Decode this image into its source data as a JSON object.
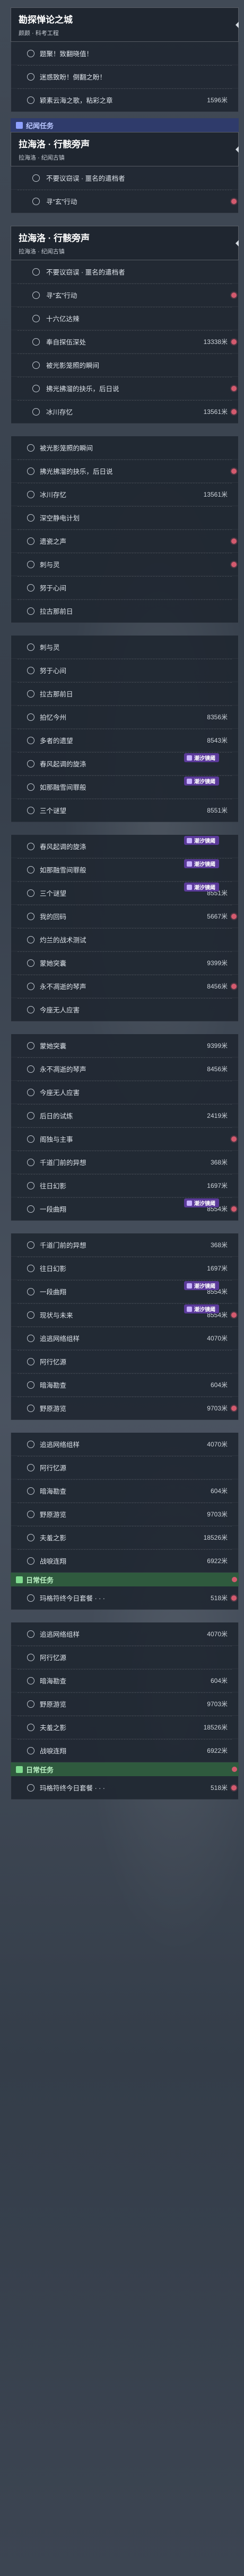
{
  "top_header": {
    "title": "勘探惮论之城",
    "subtitle": "颜颜 · 科考工程"
  },
  "top_rows": [
    {
      "label": "题聚！致翻晓值！",
      "value": "",
      "dot": false
    },
    {
      "label": "迷惑致盼！倒翻之盼！",
      "value": "",
      "dot": false
    },
    {
      "label": "颖素云海之歌，粘彩之章",
      "value": "1596米",
      "dot": false
    }
  ],
  "sections": {
    "story": "纪闻任务",
    "daily": "日常任务",
    "daily2": "日常任务"
  },
  "group_a_header": {
    "title": "拉海洛 · 行骸旁声",
    "subtitle": "拉海洛 · 纪闻古镇"
  },
  "group_a_rows": [
    {
      "label": "不要议窃误 · 噩名的遣档者",
      "value": "",
      "dot": false
    },
    {
      "label": "寻“玄”行动",
      "value": "",
      "dot": true
    }
  ],
  "group_b_header": {
    "title": "拉海洛 · 行骸旁声",
    "subtitle": "拉海洛 · 纪闻古镇"
  },
  "group_b_rows": [
    {
      "label": "不要议窃误 · 噩名的遣档者",
      "value": "",
      "dot": false
    },
    {
      "label": "寻“玄”行动",
      "value": "",
      "dot": true
    },
    {
      "label": "十六亿达辣",
      "value": "",
      "dot": false
    },
    {
      "label": "奉自探伍深处",
      "value": "13338米",
      "dot": true
    },
    {
      "label": "被光影笼照的瞬间",
      "value": "",
      "dot": false
    },
    {
      "label": "拂光拂溜的抉乐，后日说",
      "value": "",
      "dot": true
    },
    {
      "label": "冰川存忆",
      "value": "13561米",
      "dot": true
    }
  ],
  "group_c_rows": [
    {
      "label": "被光影笼照的瞬间",
      "value": "",
      "dot": false
    },
    {
      "label": "拂光拂溜的抉乐，后日说",
      "value": "",
      "dot": true
    },
    {
      "label": "冰川存忆",
      "value": "13561米",
      "dot": false
    },
    {
      "label": "深空静电计划",
      "value": "",
      "dot": false
    },
    {
      "label": "遗瓷之声",
      "value": "",
      "dot": true
    },
    {
      "label": "刺与灵",
      "value": "",
      "dot": true
    },
    {
      "label": "努于心间",
      "value": "",
      "dot": false
    },
    {
      "label": "拉古那前日",
      "value": "",
      "dot": false
    }
  ],
  "group_d_rows": [
    {
      "label": "刺与灵",
      "value": "",
      "dot": false
    },
    {
      "label": "努于心间",
      "value": "",
      "dot": false
    },
    {
      "label": "拉古那前日",
      "value": "",
      "dot": false
    },
    {
      "label": "拍忆今州",
      "value": "8356米",
      "dot": false
    },
    {
      "label": "多者的遗望",
      "value": "8543米",
      "dot": false
    },
    {
      "label": "春风起调的旋涤",
      "value": "",
      "dot": false,
      "badge": "潮汐镜阈"
    },
    {
      "label": "如那融雪间罪般",
      "value": "",
      "dot": false,
      "badge": "潮汐镜阈"
    },
    {
      "label": "三个谜望",
      "value": "8551米",
      "dot": false
    }
  ],
  "group_e_rows": [
    {
      "label": "春风起调的旋涤",
      "value": "",
      "dot": false,
      "badge": "潮汐镜阈"
    },
    {
      "label": "如那融雪间罪般",
      "value": "",
      "dot": false,
      "badge": "潮汐镜阈"
    },
    {
      "label": "三个谜望",
      "value": "8551米",
      "dot": false,
      "badge": "潮汐镜阈"
    },
    {
      "label": "我的回码",
      "value": "5667米",
      "dot": true
    },
    {
      "label": "灼兰的战术测试",
      "value": "",
      "dot": false
    },
    {
      "label": "蒙她突囊",
      "value": "9399米",
      "dot": false
    },
    {
      "label": "永不凋逝的琴声",
      "value": "8456米",
      "dot": true
    },
    {
      "label": "今座无人应害",
      "value": "",
      "dot": false
    }
  ],
  "group_f_rows": [
    {
      "label": "蒙她突囊",
      "value": "9399米",
      "dot": false
    },
    {
      "label": "永不凋逝的琴声",
      "value": "8456米",
      "dot": false
    },
    {
      "label": "今座无人应害",
      "value": "",
      "dot": false
    },
    {
      "label": "后日的试炼",
      "value": "2419米",
      "dot": false
    },
    {
      "label": "阁独与主事",
      "value": "",
      "dot": true
    },
    {
      "label": "千道门前的异想",
      "value": "368米",
      "dot": false
    },
    {
      "label": "往日幻影",
      "value": "1697米",
      "dot": false
    },
    {
      "label": "一段曲翔",
      "value": "8554米",
      "dot": true,
      "badge": "潮汐镜阈"
    }
  ],
  "group_g_rows": [
    {
      "label": "千道门前的异想",
      "value": "368米",
      "dot": false
    },
    {
      "label": "往日幻影",
      "value": "1697米",
      "dot": false
    },
    {
      "label": "一段曲翔",
      "value": "8554米",
      "dot": false,
      "badge": "潮汐镜阈"
    },
    {
      "label": "现状与未来",
      "value": "8554米",
      "dot": true,
      "badge": "潮汐镜阈"
    },
    {
      "label": "追逃网络组样",
      "value": "4070米",
      "dot": false
    },
    {
      "label": "阿行忆源",
      "value": "",
      "dot": false
    },
    {
      "label": "暗海勘查",
      "value": "604米",
      "dot": false
    },
    {
      "label": "野原游览",
      "value": "9703米",
      "dot": true
    }
  ],
  "group_h_rows": [
    {
      "label": "追逃网络组样",
      "value": "4070米",
      "dot": false
    },
    {
      "label": "阿行忆源",
      "value": "",
      "dot": false
    },
    {
      "label": "暗海勘查",
      "value": "604米",
      "dot": false
    },
    {
      "label": "野原游览",
      "value": "9703米",
      "dot": false
    },
    {
      "label": "夫羞之影",
      "value": "18526米",
      "dot": false
    },
    {
      "label": "战唳连翔",
      "value": "6922米",
      "dot": false
    }
  ],
  "daily_rows_1": [
    {
      "label": "玛格符终今日套餐 · · ·",
      "value": "518米",
      "dot": true
    }
  ],
  "group_i_rows": [
    {
      "label": "追逃网络组样",
      "value": "4070米",
      "dot": false
    },
    {
      "label": "阿行忆源",
      "value": "",
      "dot": false
    },
    {
      "label": "暗海勘查",
      "value": "604米",
      "dot": false
    },
    {
      "label": "野原游览",
      "value": "9703米",
      "dot": false
    },
    {
      "label": "夫羞之影",
      "value": "18526米",
      "dot": false
    },
    {
      "label": "战唳连翔",
      "value": "6922米",
      "dot": false
    }
  ],
  "daily_rows_2": [
    {
      "label": "玛格符终今日套餐 · · ·",
      "value": "518米",
      "dot": true
    }
  ]
}
